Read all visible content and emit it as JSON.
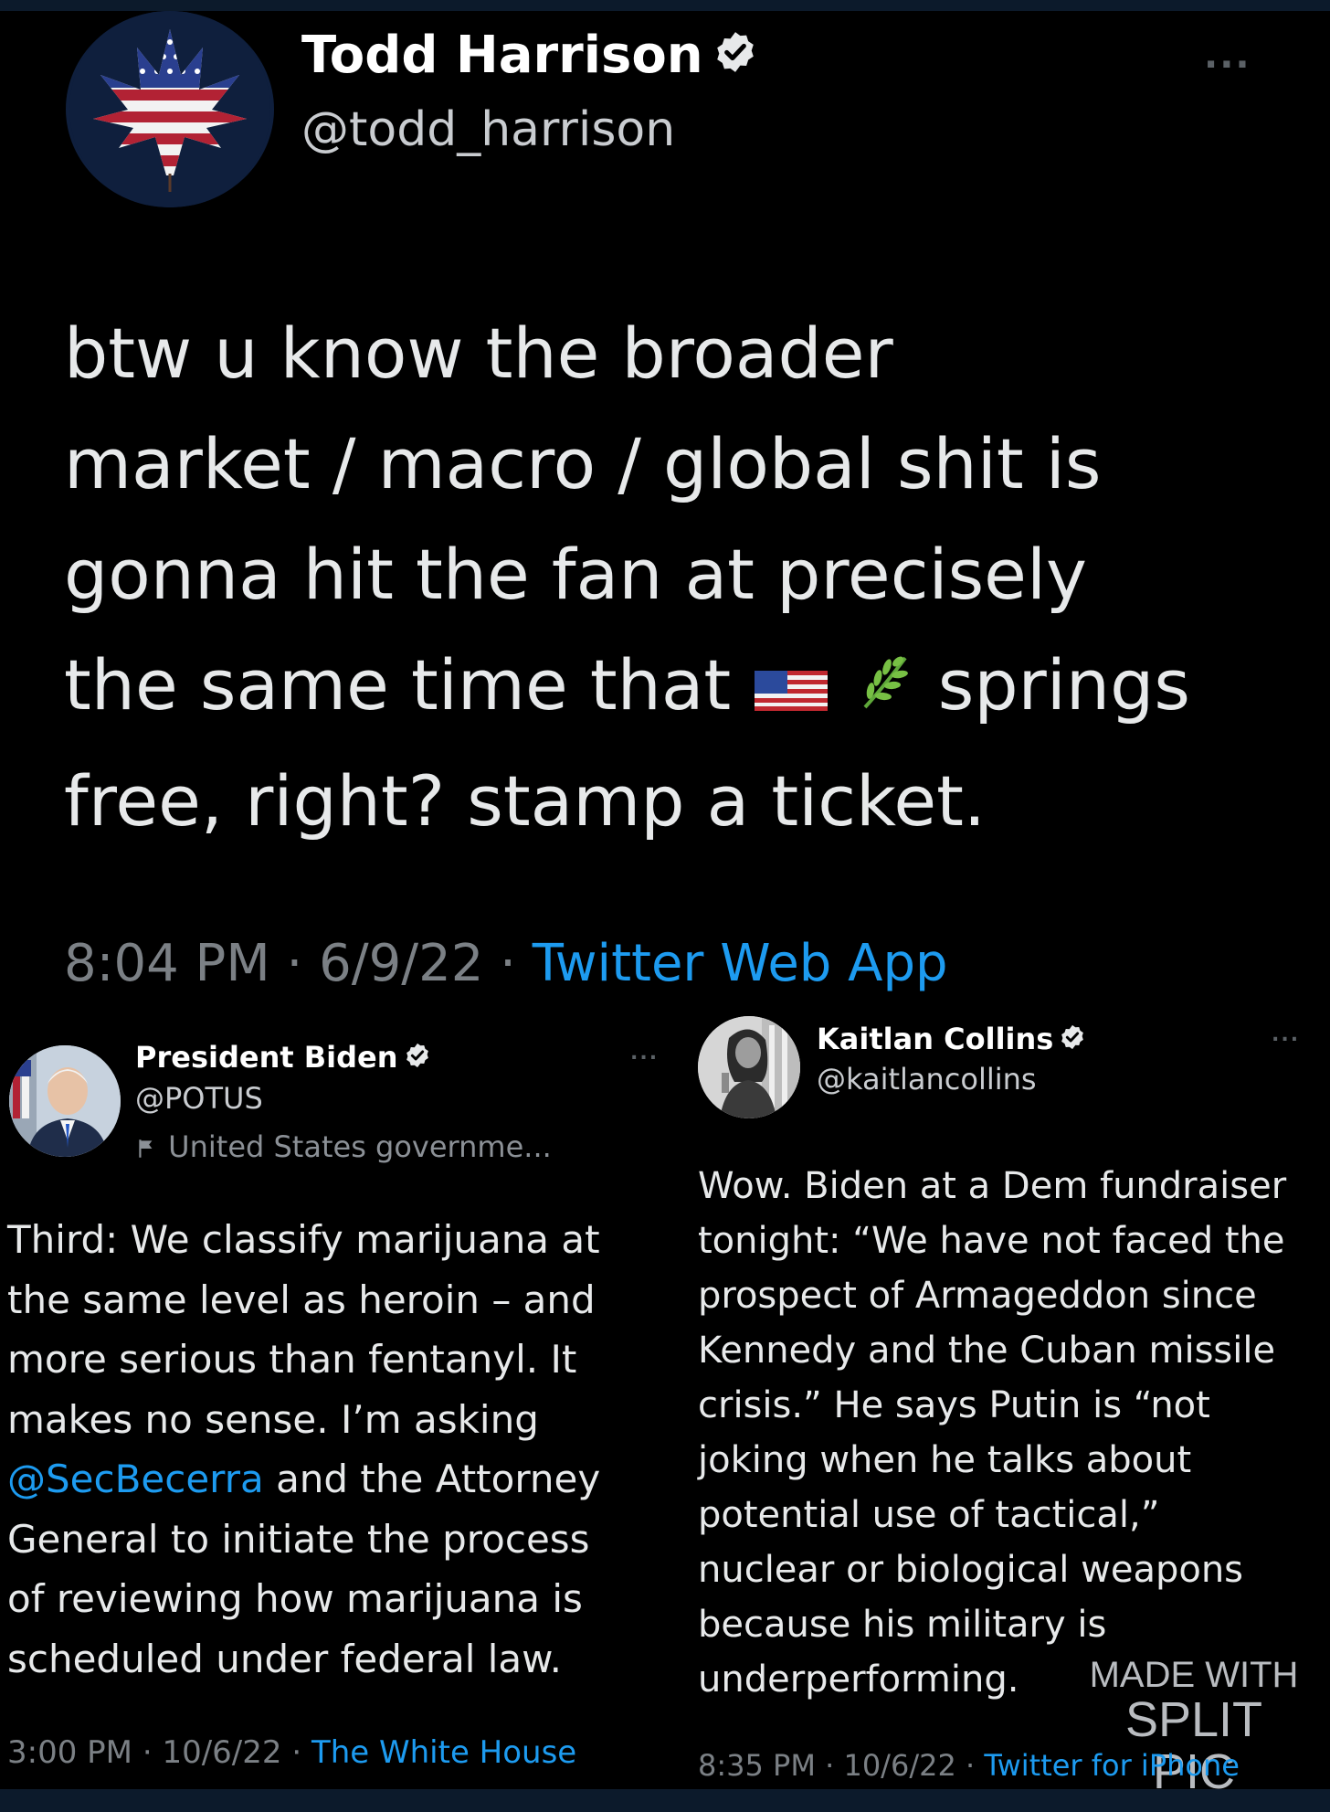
{
  "top_tweet": {
    "display_name": "Todd Harrison",
    "handle": "@todd_harrison",
    "more_label": "...",
    "body_lines": [
      "btw u know the broader",
      "market / macro / global shit is",
      "gonna hit the fan at precisely",
      "the same time that",
      "springs",
      "free, right?  stamp a ticket."
    ],
    "time": "8:04 PM",
    "date": "6/9/22",
    "source": "Twitter Web App",
    "separator": "·"
  },
  "biden_tweet": {
    "display_name": "President Biden",
    "handle": "@POTUS",
    "affiliation": "United States governme...",
    "more_label": "...",
    "body_lines": [
      "Third: We classify marijuana at",
      "the same level as heroin – and",
      "more serious than fentanyl. It",
      "makes no sense. I’m asking",
      "@SecBecerra",
      " and the Attorney",
      "General to initiate the process",
      "of reviewing how marijuana is",
      "scheduled under federal law."
    ],
    "time": "3:00 PM",
    "date": "10/6/22",
    "source": "The White House",
    "separator": "·"
  },
  "collins_tweet": {
    "display_name": "Kaitlan Collins",
    "handle": "@kaitlancollins",
    "more_label": "...",
    "body_lines": [
      "Wow. Biden at a Dem fundraiser",
      "tonight: “We have not faced the",
      "prospect of Armageddon since",
      "Kennedy and the Cuban missile",
      "crisis.” He says Putin is “not",
      "joking when he talks about",
      "potential use of tactical,”",
      "nuclear or biological weapons",
      "because his military is",
      "underperforming."
    ],
    "time": "8:35 PM",
    "date": "10/6/22",
    "source": "Twitter for iPhone",
    "separator": "·"
  },
  "watermark": {
    "line1": "MADE WITH",
    "line2": "SPLIT PIC"
  },
  "colors": {
    "background": "#000000",
    "text": "#e7e9ea",
    "muted": "#7b8085",
    "link": "#1d9bf0",
    "verified_badge": "#e7e9ea",
    "outer_band": "#0c1a2b"
  },
  "icons": {
    "verified": "verified-badge-icon",
    "more": "more-options-icon",
    "affiliation": "affiliation-flag-icon",
    "flag_emoji": "us-flag-emoji",
    "herb_emoji": "herb-emoji"
  }
}
